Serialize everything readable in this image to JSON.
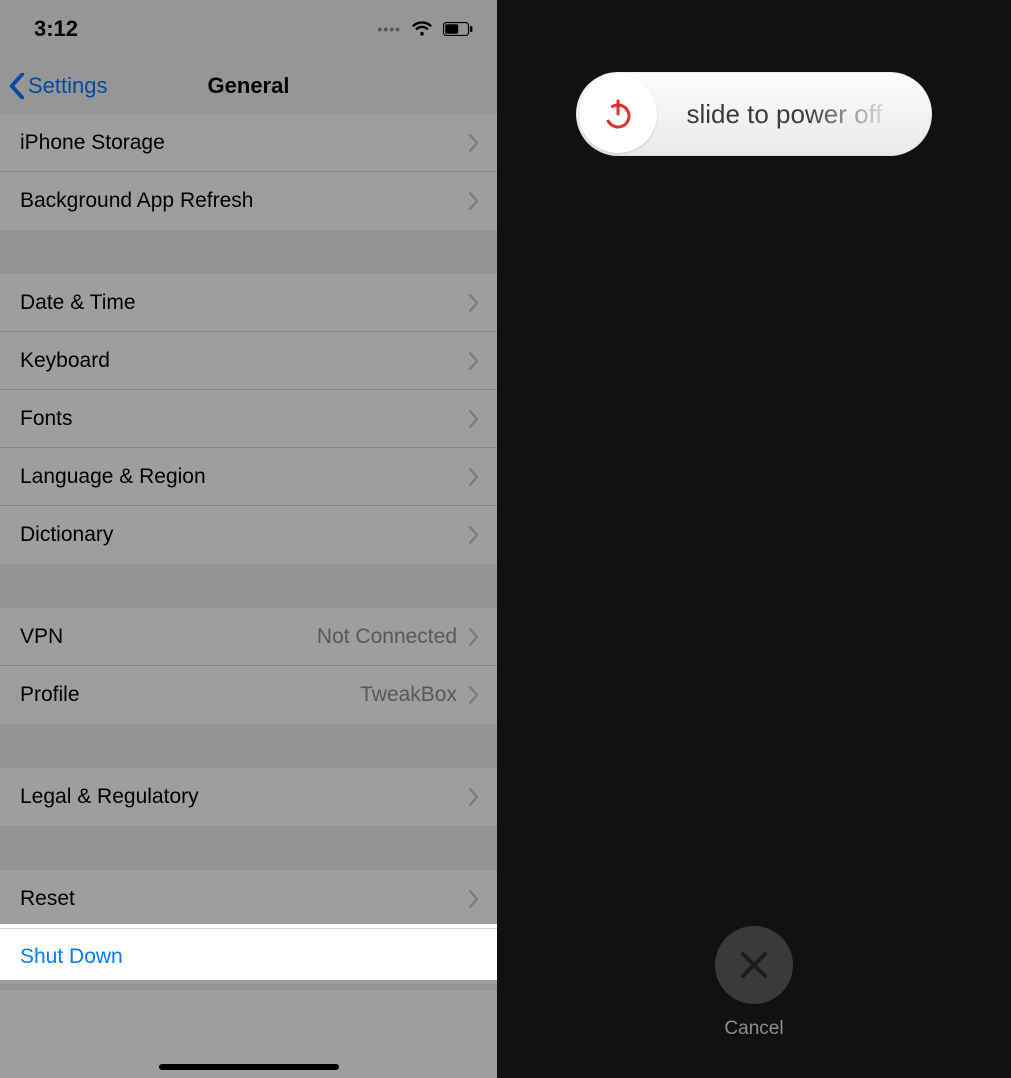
{
  "left": {
    "status": {
      "time": "3:12"
    },
    "nav": {
      "back": "Settings",
      "title": "General"
    },
    "group_top": [
      {
        "label": "iPhone Storage"
      },
      {
        "label": "Background App Refresh"
      }
    ],
    "group_datetime": [
      {
        "label": "Date & Time"
      },
      {
        "label": "Keyboard"
      },
      {
        "label": "Fonts"
      },
      {
        "label": "Language & Region"
      },
      {
        "label": "Dictionary"
      }
    ],
    "group_vpn": [
      {
        "label": "VPN",
        "detail": "Not Connected"
      },
      {
        "label": "Profile",
        "detail": "TweakBox"
      }
    ],
    "group_legal": [
      {
        "label": "Legal & Regulatory"
      }
    ],
    "group_reset": [
      {
        "label": "Reset"
      }
    ],
    "shutdown": "Shut Down"
  },
  "right": {
    "slide_text": "slide to power off",
    "cancel": "Cancel"
  }
}
